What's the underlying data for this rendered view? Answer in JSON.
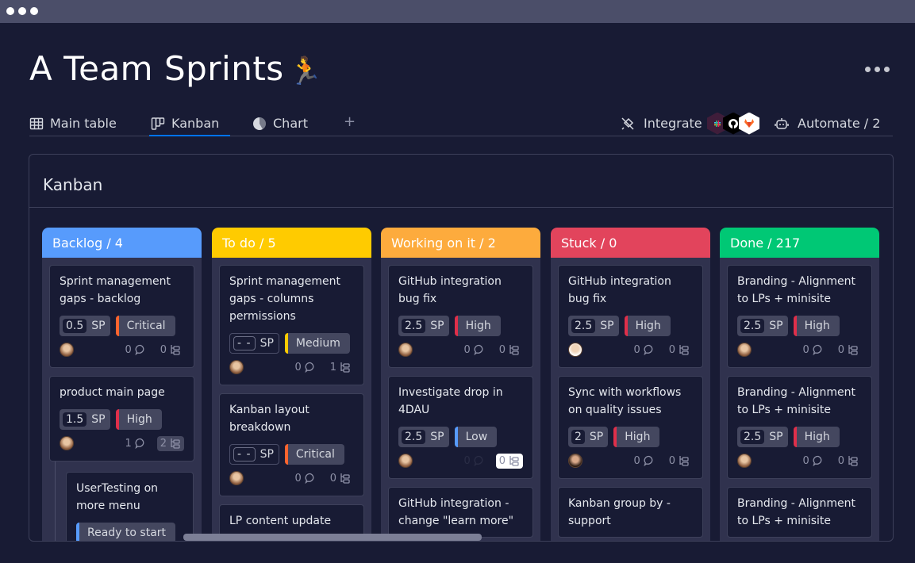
{
  "window": {
    "controls": [
      "dot",
      "dot",
      "dot"
    ]
  },
  "header": {
    "title": "A Team Sprints",
    "title_emoji": "🏃",
    "more_icon": "ellipsis-icon"
  },
  "tabs": [
    {
      "label": "Main table",
      "icon": "table-icon",
      "active": false
    },
    {
      "label": "Kanban",
      "icon": "kanban-icon",
      "active": true
    },
    {
      "label": "Chart",
      "icon": "chart-pie-icon",
      "active": false
    }
  ],
  "add_tab_label": "+",
  "toolbar": {
    "integrate_label": "Integrate",
    "integrations": [
      "slack",
      "github",
      "gitlab"
    ],
    "automate_label": "Automate / 2"
  },
  "board": {
    "title": "Kanban",
    "columns": [
      {
        "label": "Backlog / 4",
        "color": "#579bfc",
        "cards": [
          {
            "title": "Sprint management gaps - backlog",
            "sp": "0.5",
            "sp_label": "SP",
            "priority": "Critical",
            "priority_color": "#ff642e",
            "comments": "0",
            "subitems": "0"
          },
          {
            "title": "product main page",
            "sp": "1.5",
            "sp_label": "SP",
            "priority": "High",
            "priority_color": "#df2f4a",
            "comments": "1",
            "subitems": "2"
          },
          {
            "title": "UserTesting on more menu",
            "status": "Ready to start",
            "status_color": "#579bfc"
          }
        ]
      },
      {
        "label": "To do / 5",
        "color": "#ffcb00",
        "cards": [
          {
            "title": "Sprint management gaps - columns permissions",
            "sp": "- -",
            "sp_label": "SP",
            "priority": "Medium",
            "priority_color": "#ffcb00",
            "comments": "0",
            "subitems": "1"
          },
          {
            "title": "Kanban layout breakdown",
            "sp": "- -",
            "sp_label": "SP",
            "priority": "Critical",
            "priority_color": "#ff642e",
            "comments": "0",
            "subitems": "0"
          },
          {
            "title": "LP content update"
          }
        ]
      },
      {
        "label": "Working on it / 2",
        "color": "#fdab3d",
        "cards": [
          {
            "title": "GitHub integration bug fix",
            "sp": "2.5",
            "sp_label": "SP",
            "priority": "High",
            "priority_color": "#df2f4a",
            "comments": "0",
            "subitems": "0"
          },
          {
            "title": "Investigate drop in 4DAU",
            "sp": "2.5",
            "sp_label": "SP",
            "priority": "Low",
            "priority_color": "#579bfc",
            "comments": "0",
            "subitems": "0"
          },
          {
            "title": "GitHub integration - change \"learn more\""
          }
        ]
      },
      {
        "label": "Stuck / 0",
        "color": "#e2445c",
        "cards": [
          {
            "title": "GitHub integration bug fix",
            "sp": "2.5",
            "sp_label": "SP",
            "priority": "High",
            "priority_color": "#df2f4a",
            "comments": "0",
            "subitems": "0"
          },
          {
            "title": "Sync with workflows on quality issues",
            "sp": "2",
            "sp_label": "SP",
            "priority": "High",
            "priority_color": "#df2f4a",
            "comments": "0",
            "subitems": "0"
          },
          {
            "title": "Kanban group by - support"
          }
        ]
      },
      {
        "label": "Done  / 217",
        "color": "#00c875",
        "cards": [
          {
            "title": "Branding  - Alignment to LPs + minisite",
            "sp": "2.5",
            "sp_label": "SP",
            "priority": "High",
            "priority_color": "#df2f4a",
            "comments": "0",
            "subitems": "0"
          },
          {
            "title": "Branding  - Alignment to LPs + minisite",
            "sp": "2.5",
            "sp_label": "SP",
            "priority": "High",
            "priority_color": "#df2f4a",
            "comments": "0",
            "subitems": "0"
          },
          {
            "title": "Branding  - Alignment to LPs + minisite"
          }
        ]
      }
    ]
  }
}
